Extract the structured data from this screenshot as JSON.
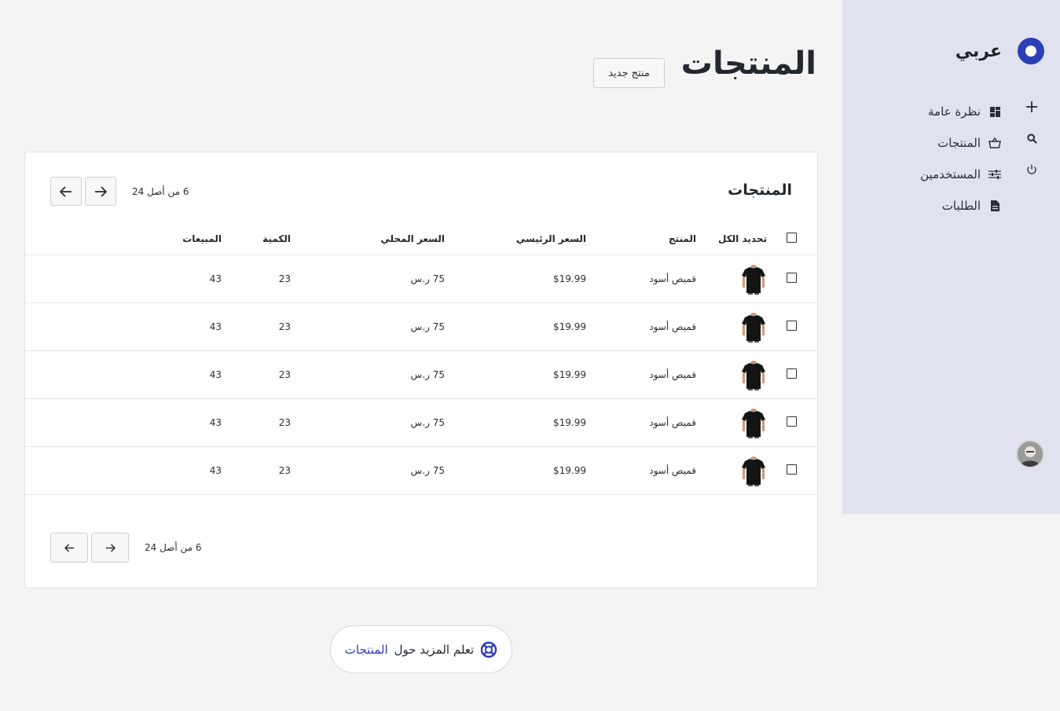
{
  "brand": {
    "name": "عربي"
  },
  "nav": [
    {
      "label": "نظرة عامة",
      "icon": "dashboard-icon"
    },
    {
      "label": "المنتجات",
      "icon": "basket-icon"
    },
    {
      "label": "المستخدمين",
      "icon": "sliders-icon"
    },
    {
      "label": "الطلبات",
      "icon": "document-icon"
    }
  ],
  "side_actions": [
    "plus-icon",
    "search-icon",
    "power-icon"
  ],
  "page": {
    "title": "المنتجات",
    "new_button": "منتج جديد"
  },
  "card": {
    "title": "المنتجات",
    "pager_count": "6 من أصل 24",
    "columns": {
      "select_all": "تحديد الكل",
      "product": "المنتج",
      "main_price": "السعر الرئيسي",
      "local_price": "السعر المحلي",
      "quantity": "الكمية",
      "sales": "المبيعات"
    },
    "rows": [
      {
        "product": "قميص أسود",
        "main_price": "$19.99",
        "local_price": "75 ر.س",
        "quantity": "23",
        "sales": "43"
      },
      {
        "product": "قميص أسود",
        "main_price": "$19.99",
        "local_price": "75 ر.س",
        "quantity": "23",
        "sales": "43"
      },
      {
        "product": "قميص أسود",
        "main_price": "$19.99",
        "local_price": "75 ر.س",
        "quantity": "23",
        "sales": "43"
      },
      {
        "product": "قميص أسود",
        "main_price": "$19.99",
        "local_price": "75 ر.س",
        "quantity": "23",
        "sales": "43"
      },
      {
        "product": "قميص أسود",
        "main_price": "$19.99",
        "local_price": "75 ر.س",
        "quantity": "23",
        "sales": "43"
      }
    ]
  },
  "learn_more": {
    "prefix": "تعلم المزيد حول",
    "link": "المنتجات"
  },
  "colors": {
    "accent": "#2d3fb5",
    "sidebar_bg": "#e0e2ef",
    "page_bg": "#f4f4f4"
  }
}
